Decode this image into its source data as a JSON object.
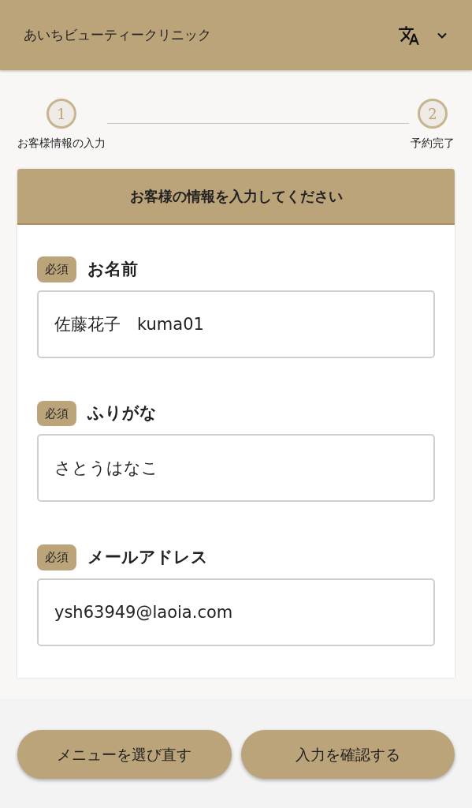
{
  "header": {
    "title": "あいちビューティークリニック"
  },
  "steps": [
    {
      "number": "1",
      "label": "お客様情報の入力"
    },
    {
      "number": "2",
      "label": "予約完了"
    }
  ],
  "form": {
    "title": "お客様の情報を入力してください",
    "fields": [
      {
        "badge": "必須",
        "label": "お名前",
        "value": "佐藤花子　kuma01"
      },
      {
        "badge": "必須",
        "label": "ふりがな",
        "value": "さとうはなこ"
      },
      {
        "badge": "必須",
        "label": "メールアドレス",
        "value": "ysh63949@laoia.com"
      }
    ]
  },
  "buttons": [
    "メニューを選び直す",
    "入力を確認する"
  ]
}
